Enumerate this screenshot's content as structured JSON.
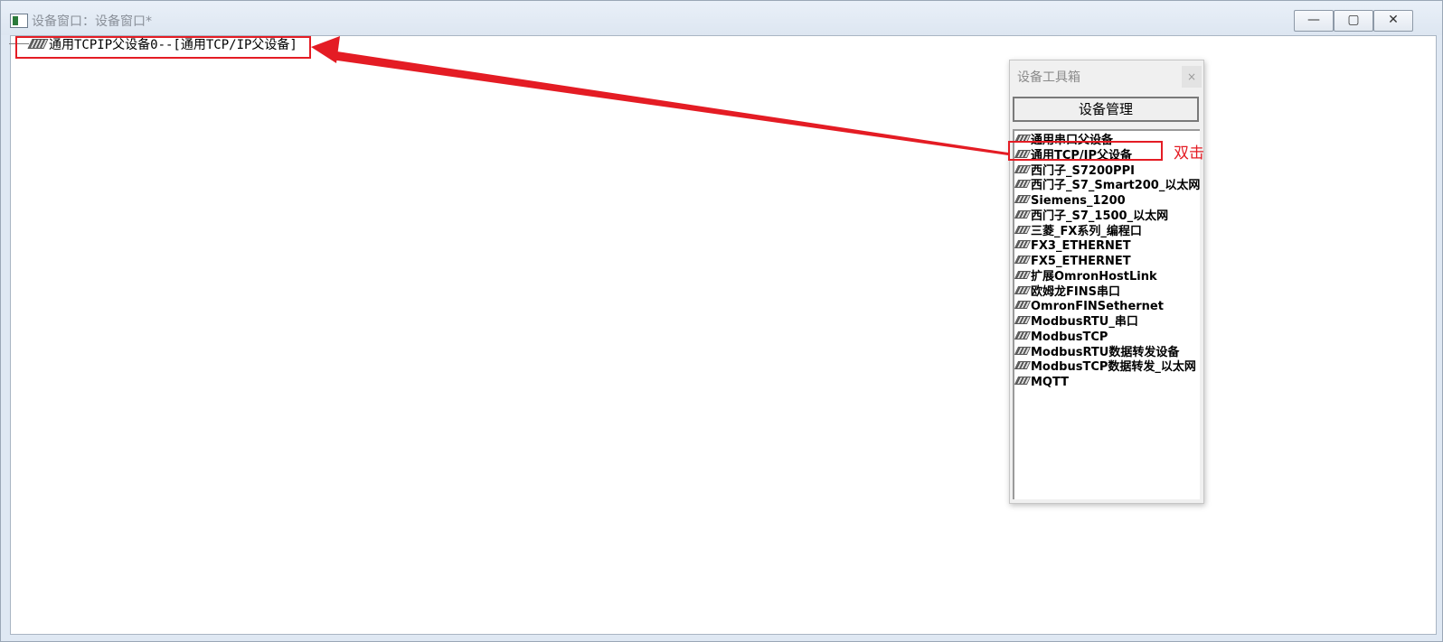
{
  "window": {
    "title": "设备窗口：设备窗口*",
    "controls": {
      "minimize": "—",
      "maximize": "▢",
      "close": "✕"
    }
  },
  "tree": {
    "node_label": "通用TCPIP父设备0--[通用TCP/IP父设备]"
  },
  "toolbox": {
    "title": "设备工具箱",
    "close_label": "×",
    "manage_button": "设备管理",
    "items": [
      "通用串口父设备",
      "通用TCP/IP父设备",
      "西门子_S7200PPI",
      "西门子_S7_Smart200_以太网",
      "Siemens_1200",
      "西门子_S7_1500_以太网",
      "三菱_FX系列_编程口",
      "FX3_ETHERNET",
      "FX5_ETHERNET",
      "扩展OmronHostLink",
      "欧姆龙FINS串口",
      "OmronFINSethernet",
      "ModbusRTU_串口",
      "ModbusTCP",
      "ModbusRTU数据转发设备",
      "ModbusTCP数据转发_以太网",
      "MQTT"
    ]
  },
  "annotation": {
    "text": "双击",
    "color": "#e41c24"
  }
}
